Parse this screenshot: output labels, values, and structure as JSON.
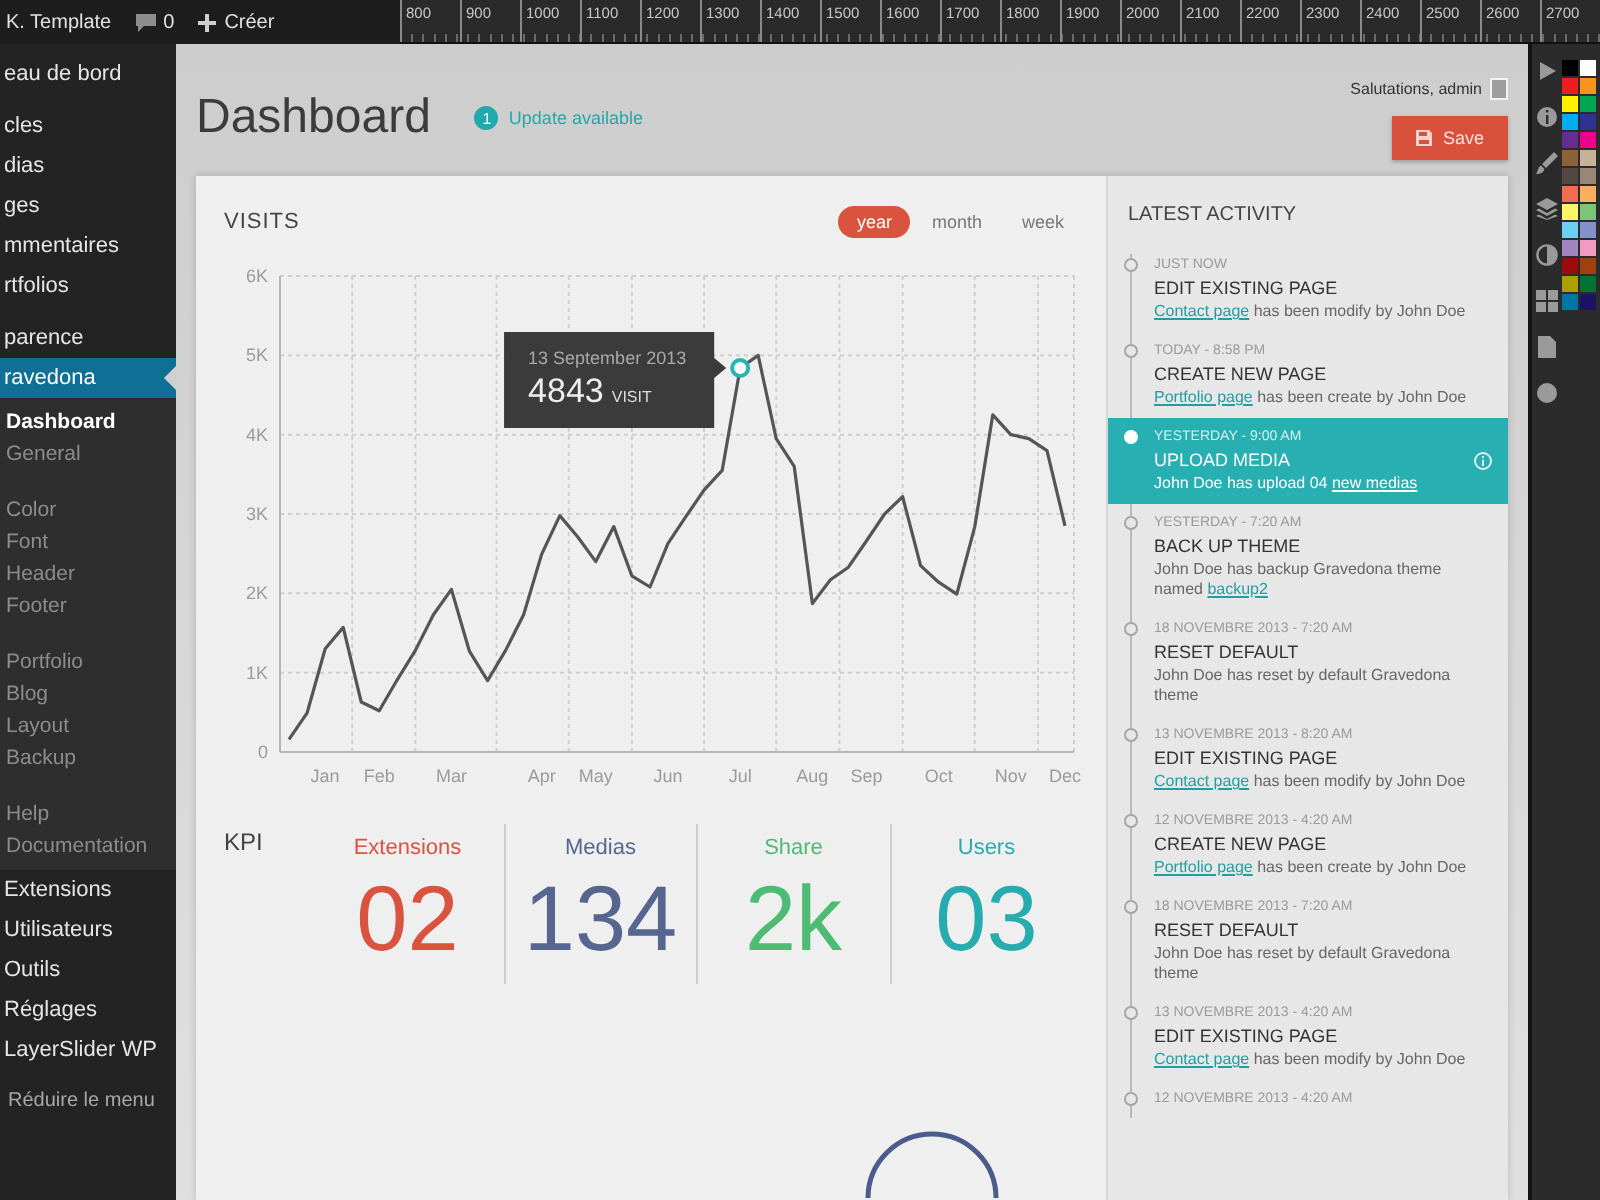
{
  "admin_bar": {
    "site": "K. Template",
    "comments": "0",
    "new": "Créer"
  },
  "ruler": {
    "marks": [
      "800",
      "900",
      "1000",
      "1100",
      "1200",
      "1300",
      "1400",
      "1500",
      "1600",
      "1700",
      "1800",
      "1900",
      "2000",
      "2100",
      "2200",
      "2300",
      "2400",
      "2500",
      "2600",
      "2700"
    ]
  },
  "sidebar": {
    "groups": [
      {
        "items": [
          {
            "label": "eau de bord",
            "selected": false
          }
        ]
      },
      {
        "items": [
          {
            "label": "cles",
            "selected": false
          },
          {
            "label": "dias",
            "selected": false
          },
          {
            "label": "ges",
            "selected": false
          },
          {
            "label": "mmentaires",
            "selected": false
          },
          {
            "label": "rtfolios",
            "selected": false
          }
        ]
      },
      {
        "items": [
          {
            "label": "parence",
            "selected": false
          },
          {
            "label": "ravedona",
            "selected": true,
            "children": [
              {
                "items": [
                  {
                    "label": "Dashboard",
                    "selected": true
                  },
                  {
                    "label": "General",
                    "selected": false
                  }
                ]
              },
              {
                "items": [
                  {
                    "label": "Color",
                    "selected": false
                  },
                  {
                    "label": "Font",
                    "selected": false
                  },
                  {
                    "label": "Header",
                    "selected": false
                  },
                  {
                    "label": "Footer",
                    "selected": false
                  }
                ]
              },
              {
                "items": [
                  {
                    "label": "Portfolio",
                    "selected": false
                  },
                  {
                    "label": "Blog",
                    "selected": false
                  },
                  {
                    "label": "Layout",
                    "selected": false
                  },
                  {
                    "label": "Backup",
                    "selected": false
                  }
                ]
              },
              {
                "items": [
                  {
                    "label": "Help",
                    "selected": false
                  },
                  {
                    "label": "Documentation",
                    "selected": false
                  }
                ]
              }
            ]
          },
          {
            "label": "Extensions",
            "selected": false
          },
          {
            "label": "Utilisateurs",
            "selected": false
          },
          {
            "label": "Outils",
            "selected": false
          },
          {
            "label": "Réglages",
            "selected": false
          },
          {
            "label": "LayerSlider WP",
            "selected": false
          }
        ]
      }
    ],
    "collapse": "Réduire le menu"
  },
  "header": {
    "title": "Dashboard",
    "update": {
      "count": "1",
      "label": "Update available"
    },
    "greeting": "Salutations, admin",
    "save": "Save"
  },
  "visits": {
    "range_tabs": [
      {
        "label": "year",
        "selected": true
      },
      {
        "label": "month",
        "selected": false
      },
      {
        "label": "week",
        "selected": false
      }
    ],
    "chart_data": {
      "type": "line",
      "title": "VISITS",
      "categories": [
        null,
        null,
        "Jan",
        null,
        null,
        "Feb",
        null,
        null,
        null,
        "Mar",
        null,
        null,
        null,
        null,
        "Apr",
        null,
        null,
        "May",
        null,
        null,
        null,
        "Jun",
        null,
        null,
        null,
        "Jul",
        null,
        null,
        null,
        "Aug",
        null,
        null,
        "Sep",
        null,
        null,
        null,
        "Oct",
        null,
        null,
        null,
        "Nov",
        null,
        null,
        "Dec"
      ],
      "values": [
        160,
        490,
        1300,
        1570,
        630,
        520,
        910,
        1280,
        1730,
        2050,
        1270,
        900,
        1280,
        1730,
        2490,
        2980,
        2710,
        2400,
        2840,
        2220,
        2080,
        2630,
        2970,
        3300,
        3550,
        4840,
        5000,
        3950,
        3600,
        1870,
        2170,
        2330,
        2660,
        3000,
        3220,
        2350,
        2140,
        1990,
        2840,
        4250,
        4000,
        3950,
        3800,
        2850
      ],
      "ylim": [
        0,
        6000
      ],
      "yticks": [
        {
          "value": 0,
          "label": "0"
        },
        {
          "value": 1000,
          "label": "1K"
        },
        {
          "value": 2000,
          "label": "2K"
        },
        {
          "value": 3000,
          "label": "3K"
        },
        {
          "value": 4000,
          "label": "4K"
        },
        {
          "value": 5000,
          "label": "5K"
        },
        {
          "value": 6000,
          "label": "6K"
        }
      ],
      "grid": true,
      "annotations": [
        {
          "x": "Jul"
        }
      ]
    },
    "tooltip": {
      "date": "13 September 2013",
      "value": "4843",
      "unit": "VISIT"
    }
  },
  "kpi": {
    "title": "KPI",
    "items": [
      {
        "label": "Extensions",
        "value": "02",
        "color": "#d9533f"
      },
      {
        "label": "Medias",
        "value": "134",
        "color": "#56668f"
      },
      {
        "label": "Share",
        "value": "2k",
        "color": "#4cbb74"
      },
      {
        "label": "Users",
        "value": "03",
        "color": "#26acae"
      }
    ]
  },
  "activity": {
    "title": "LATEST ACTIVITY",
    "items": [
      {
        "time": "JUST NOW",
        "title": "EDIT EXISTING PAGE",
        "desc": [
          {
            "kind": "link",
            "text": "Contact page"
          },
          {
            "kind": "text",
            "text": "has been modify by John Doe"
          }
        ],
        "selected": false
      },
      {
        "time": "TODAY - 8:58 PM",
        "title": "CREATE NEW PAGE",
        "desc": [
          {
            "kind": "link",
            "text": "Portfolio page"
          },
          {
            "kind": "text",
            "text": "has been create by John Doe"
          }
        ],
        "selected": false
      },
      {
        "time": "YESTERDAY - 9:00 AM",
        "title": "UPLOAD MEDIA",
        "desc": [
          {
            "kind": "text",
            "text": "John Doe has upload 04"
          },
          {
            "kind": "link",
            "text": "new medias"
          }
        ],
        "selected": true
      },
      {
        "time": "YESTERDAY - 7:20 AM",
        "title": "BACK UP THEME",
        "desc": [
          {
            "kind": "text",
            "text": "John Doe has backup Gravedona theme named"
          },
          {
            "kind": "link",
            "text": "backup2"
          }
        ],
        "selected": false
      },
      {
        "time": "18 NOVEMBRE 2013 - 7:20 AM",
        "title": "RESET DEFAULT",
        "desc": [
          {
            "kind": "text",
            "text": "John Doe has reset by default Gravedona theme"
          }
        ],
        "selected": false
      },
      {
        "time": "13 NOVEMBRE 2013 - 8:20 AM",
        "title": "EDIT EXISTING PAGE",
        "desc": [
          {
            "kind": "link",
            "text": "Contact page"
          },
          {
            "kind": "text",
            "text": "has been modify by John Doe"
          }
        ],
        "selected": false
      },
      {
        "time": "12 NOVEMBRE 2013 - 4:20 AM",
        "title": "CREATE NEW PAGE",
        "desc": [
          {
            "kind": "link",
            "text": "Portfolio page"
          },
          {
            "kind": "text",
            "text": "has been create by John Doe"
          }
        ],
        "selected": false
      },
      {
        "time": "18 NOVEMBRE 2013 - 7:20 AM",
        "title": "RESET DEFAULT",
        "desc": [
          {
            "kind": "text",
            "text": "John Doe has reset by default Gravedona theme"
          }
        ],
        "selected": false
      },
      {
        "time": "13 NOVEMBRE 2013 - 4:20 AM",
        "title": "EDIT EXISTING PAGE",
        "desc": [
          {
            "kind": "link",
            "text": "Contact page"
          },
          {
            "kind": "text",
            "text": "has been modify by John Doe"
          }
        ],
        "selected": false
      },
      {
        "time": "12 NOVEMBRE 2013 - 4:20 AM",
        "selected": false
      }
    ]
  }
}
